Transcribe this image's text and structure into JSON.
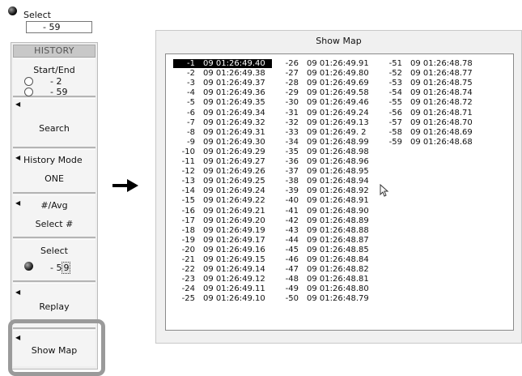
{
  "select_top": {
    "label": "Select",
    "value": "-   59"
  },
  "panel": {
    "header": "HISTORY",
    "start_end": {
      "label": "Start/End",
      "start": "-  2",
      "end": "-  59"
    },
    "search_label": "Search",
    "history_mode": {
      "label": "History Mode",
      "value": "ONE"
    },
    "avg": {
      "label": "#/Avg",
      "value": "Select #"
    },
    "select": {
      "label": "Select",
      "value_prefix": "-  5",
      "value_cursor": "9"
    },
    "replay_label": "Replay",
    "show_map_label": "Show Map"
  },
  "window": {
    "title": "Show Map"
  },
  "columns": [
    [
      {
        "n": "-1",
        "t": "09 01:26:49.40"
      },
      {
        "n": "-2",
        "t": "09 01:26:49.38"
      },
      {
        "n": "-3",
        "t": "09 01:26:49.37"
      },
      {
        "n": "-4",
        "t": "09 01:26:49.36"
      },
      {
        "n": "-5",
        "t": "09 01:26:49.35"
      },
      {
        "n": "-6",
        "t": "09 01:26:49.34"
      },
      {
        "n": "-7",
        "t": "09 01:26:49.32"
      },
      {
        "n": "-8",
        "t": "09 01:26:49.31"
      },
      {
        "n": "-9",
        "t": "09 01:26:49.30"
      },
      {
        "n": "-10",
        "t": "09 01:26:49.29"
      },
      {
        "n": "-11",
        "t": "09 01:26:49.27"
      },
      {
        "n": "-12",
        "t": "09 01:26:49.26"
      },
      {
        "n": "-13",
        "t": "09 01:26:49.25"
      },
      {
        "n": "-14",
        "t": "09 01:26:49.24"
      },
      {
        "n": "-15",
        "t": "09 01:26:49.22"
      },
      {
        "n": "-16",
        "t": "09 01:26:49.21"
      },
      {
        "n": "-17",
        "t": "09 01:26:49.20"
      },
      {
        "n": "-18",
        "t": "09 01:26:49.19"
      },
      {
        "n": "-19",
        "t": "09 01:26:49.17"
      },
      {
        "n": "-20",
        "t": "09 01:26:49.16"
      },
      {
        "n": "-21",
        "t": "09 01:26:49.15"
      },
      {
        "n": "-22",
        "t": "09 01:26:49.14"
      },
      {
        "n": "-23",
        "t": "09 01:26:49.12"
      },
      {
        "n": "-24",
        "t": "09 01:26:49.11"
      },
      {
        "n": "-25",
        "t": "09 01:26:49.10"
      }
    ],
    [
      {
        "n": "-26",
        "t": "09 01:26:49.91"
      },
      {
        "n": "-27",
        "t": "09 01:26:49.80"
      },
      {
        "n": "-28",
        "t": "09 01:26:49.69"
      },
      {
        "n": "-29",
        "t": "09 01:26:49.58"
      },
      {
        "n": "-30",
        "t": "09 01:26:49.46"
      },
      {
        "n": "-31",
        "t": "09 01:26:49.24"
      },
      {
        "n": "-32",
        "t": "09 01:26:49.13"
      },
      {
        "n": "-33",
        "t": "09 01:26:49. 2"
      },
      {
        "n": "-34",
        "t": "09 01:26:48.99"
      },
      {
        "n": "-35",
        "t": "09 01:26:48.98"
      },
      {
        "n": "-36",
        "t": "09 01:26:48.96"
      },
      {
        "n": "-37",
        "t": "09 01:26:48.95"
      },
      {
        "n": "-38",
        "t": "09 01:26:48.94"
      },
      {
        "n": "-39",
        "t": "09 01:26:48.92"
      },
      {
        "n": "-40",
        "t": "09 01:26:48.91"
      },
      {
        "n": "-41",
        "t": "09 01:26:48.90"
      },
      {
        "n": "-42",
        "t": "09 01:26:48.89"
      },
      {
        "n": "-43",
        "t": "09 01:26:48.88"
      },
      {
        "n": "-44",
        "t": "09 01:26:48.87"
      },
      {
        "n": "-45",
        "t": "09 01:26:48.85"
      },
      {
        "n": "-46",
        "t": "09 01:26:48.84"
      },
      {
        "n": "-47",
        "t": "09 01:26:48.82"
      },
      {
        "n": "-48",
        "t": "09 01:26:48.81"
      },
      {
        "n": "-49",
        "t": "09 01:26:48.80"
      },
      {
        "n": "-50",
        "t": "09 01:26:48.79"
      }
    ],
    [
      {
        "n": "-51",
        "t": "09 01:26:48.78"
      },
      {
        "n": "-52",
        "t": "09 01:26:48.77"
      },
      {
        "n": "-53",
        "t": "09 01:26:48.75"
      },
      {
        "n": "-54",
        "t": "09 01:26:48.74"
      },
      {
        "n": "-55",
        "t": "09 01:26:48.72"
      },
      {
        "n": "-56",
        "t": "09 01:26:48.71"
      },
      {
        "n": "-57",
        "t": "09 01:26:48.70"
      },
      {
        "n": "-58",
        "t": "09 01:26:48.69"
      },
      {
        "n": "-59",
        "t": "09 01:26:48.68"
      }
    ]
  ],
  "selected_entry": "-1",
  "icons": {
    "select_dial": "knob-icon",
    "start_radio": "radio-icon",
    "end_radio": "radio-icon",
    "softkey_arrow": "triangle-left-icon",
    "right_arrow": "arrow-right-icon",
    "mouse_pointer": "mouse-pointer-icon"
  }
}
